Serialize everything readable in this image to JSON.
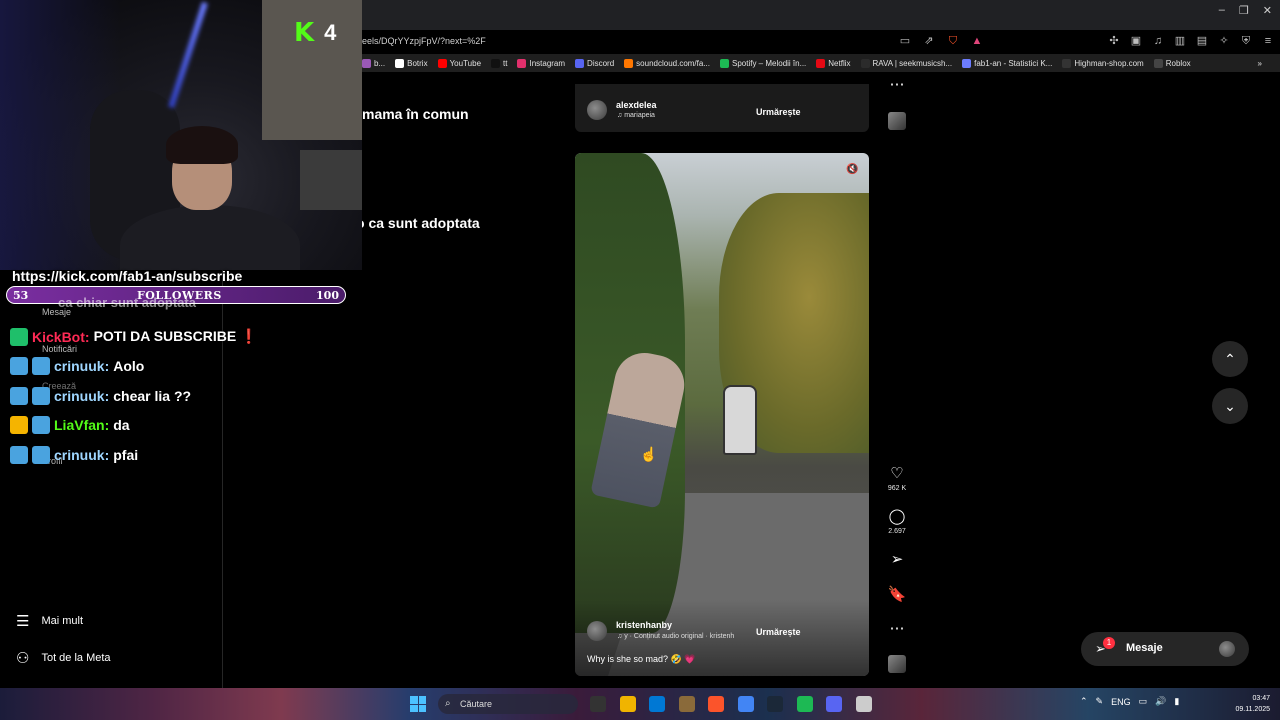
{
  "browser": {
    "url": "eels/DQrYYzpjFpV/?next=%2F",
    "window_controls": [
      "–",
      "❐",
      "✕"
    ],
    "bookmarks": [
      {
        "label": "b...",
        "color": "#9b59b6"
      },
      {
        "label": "Botrix",
        "color": "#ffffff"
      },
      {
        "label": "YouTube",
        "color": "#ff0000"
      },
      {
        "label": "tt",
        "color": "#111111"
      },
      {
        "label": "Instagram",
        "color": "#e1306c"
      },
      {
        "label": "Discord",
        "color": "#5865f2"
      },
      {
        "label": "soundcloud.com/fa...",
        "color": "#ff7700"
      },
      {
        "label": "Spotify – Melodii în...",
        "color": "#1db954"
      },
      {
        "label": "Netflix",
        "color": "#e50914"
      },
      {
        "label": "RAVA | seekmusicsh...",
        "color": "#2b2b2b"
      },
      {
        "label": "fab1-an - Statistici K...",
        "color": "#6c7cff"
      },
      {
        "label": "Highman-shop.com",
        "color": "#333333"
      },
      {
        "label": "Roblox",
        "color": "#444444"
      }
    ],
    "bookmarks_more": "»"
  },
  "stream": {
    "viewer_count": "4",
    "subscribe_url": "https://kick.com/fab1-an/subscribe",
    "followers": {
      "current": "53",
      "label": "FOLLOWERS",
      "goal": "100",
      "progress": 0.53
    }
  },
  "chat": [
    {
      "user": "KickBot:",
      "message": "POTI DA SUBSCRIBE ❗",
      "user_color": "#ff2a55",
      "badges": [
        "#1fbf6a"
      ]
    },
    {
      "user": "crinuuk:",
      "message": "Aolo",
      "user_color": "#9fd6ff",
      "badges": [
        "#4aa3df",
        "#4aa3df"
      ]
    },
    {
      "user": "crinuuk:",
      "message": "chear lia ??",
      "user_color": "#9fd6ff",
      "badges": [
        "#4aa3df",
        "#4aa3df"
      ]
    },
    {
      "user": "LiaVfan:",
      "message": "da",
      "user_color": "#53fc18",
      "badges": [
        "#f5b400",
        "#4aa3df"
      ]
    },
    {
      "user": "crinuuk:",
      "message": "pfai",
      "user_color": "#9fd6ff",
      "badges": [
        "#4aa3df",
        "#4aa3df"
      ]
    }
  ],
  "background_captions": {
    "caption_1": "mama în comun",
    "caption_2": "o ca sunt adoptata",
    "caption_3": "ca chiar sunt adoptata"
  },
  "ig_nav_ghost": {
    "messages": "Mesaje",
    "notifications": "Notificări",
    "create": "Creează",
    "profile": "Profil"
  },
  "ig_nav": {
    "more": "Mai mult",
    "meta": "Tot de la Meta"
  },
  "prev_reel": {
    "username": "alexdelea",
    "audio": "mariapeia",
    "follow": "Urmărește"
  },
  "reel": {
    "username": "kristenhanby",
    "audio": "y · Conținut audio original · kristenh",
    "follow": "Urmărește",
    "caption": "Why is she so mad? 🤣 💗",
    "likes": "962 K",
    "comments": "2.697"
  },
  "icons": {
    "more": "⋯",
    "like": "♡",
    "comment": "◯",
    "share": "➢",
    "save": "🔖",
    "up": "⌃",
    "down": "⌄",
    "mute": "🔇",
    "menu": "☰",
    "meta": "⚇",
    "send": "➢"
  },
  "messages_button": {
    "label": "Mesaje",
    "badge": "1"
  },
  "taskbar": {
    "search": "Căutare",
    "lang": "ENG",
    "time": "03:47",
    "date": "09.11.2025",
    "apps": [
      "#333333",
      "#f0b400",
      "#0078d4",
      "#8a6a3a",
      "#fb542b",
      "#4285f4",
      "#1b2838",
      "#1db954",
      "#5865f2",
      "#cccccc"
    ]
  }
}
